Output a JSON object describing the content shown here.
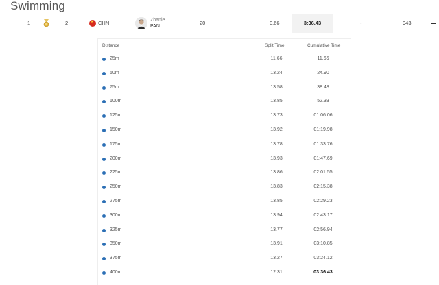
{
  "page": {
    "title": "Swimming"
  },
  "result": {
    "rank": "1",
    "medal_icon": "gold-medal-icon",
    "lane": "2",
    "noc_flag_icon": "china-flag-icon",
    "noc": "CHN",
    "athlete_first": "Zhanle",
    "athlete_last": "PAN",
    "age": "20",
    "reaction": "0.66",
    "time": "3:36.43",
    "behind": "-",
    "points": "943"
  },
  "splits": {
    "headers": {
      "distance": "Distance",
      "split": "Split Time",
      "cumulative": "Cumulative Time"
    },
    "rows": [
      {
        "distance": "25m",
        "split": "11.66",
        "cumulative": "11.66"
      },
      {
        "distance": "50m",
        "split": "13.24",
        "cumulative": "24.90"
      },
      {
        "distance": "75m",
        "split": "13.58",
        "cumulative": "38.48"
      },
      {
        "distance": "100m",
        "split": "13.85",
        "cumulative": "52.33"
      },
      {
        "distance": "125m",
        "split": "13.73",
        "cumulative": "01:06.06"
      },
      {
        "distance": "150m",
        "split": "13.92",
        "cumulative": "01:19.98"
      },
      {
        "distance": "175m",
        "split": "13.78",
        "cumulative": "01:33.76"
      },
      {
        "distance": "200m",
        "split": "13.93",
        "cumulative": "01:47.69"
      },
      {
        "distance": "225m",
        "split": "13.86",
        "cumulative": "02:01.55"
      },
      {
        "distance": "250m",
        "split": "13.83",
        "cumulative": "02:15.38"
      },
      {
        "distance": "275m",
        "split": "13.85",
        "cumulative": "02:29.23"
      },
      {
        "distance": "300m",
        "split": "13.94",
        "cumulative": "02:43.17"
      },
      {
        "distance": "325m",
        "split": "13.77",
        "cumulative": "02:56.94"
      },
      {
        "distance": "350m",
        "split": "13.91",
        "cumulative": "03:10.85"
      },
      {
        "distance": "375m",
        "split": "13.27",
        "cumulative": "03:24.12"
      },
      {
        "distance": "400m",
        "split": "12.31",
        "cumulative": "03:36.43"
      }
    ]
  }
}
